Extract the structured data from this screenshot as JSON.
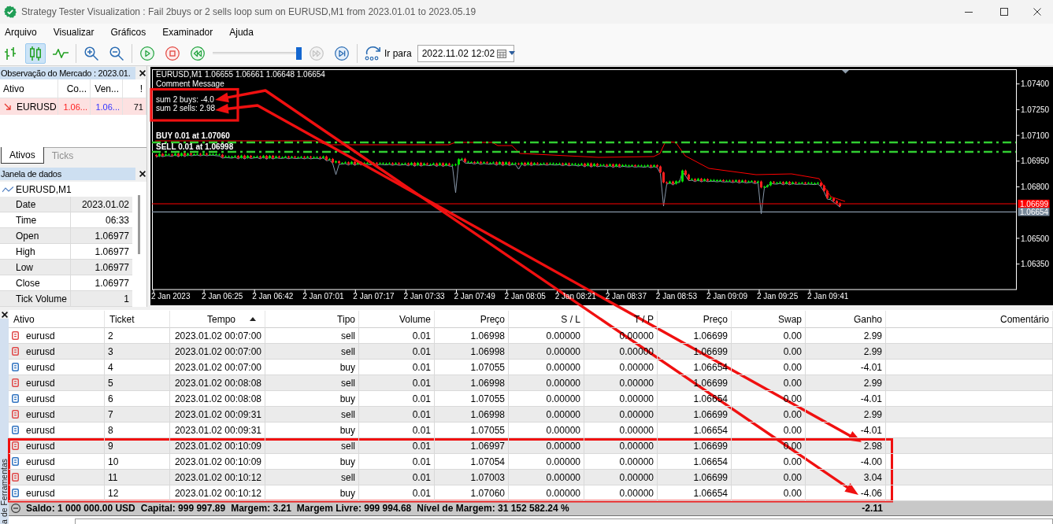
{
  "window": {
    "title": "Strategy Tester Visualization : Fail 2buys or 2 sells loop sum on EURUSD,M1 from 2023.01.01 to 2023.05.19"
  },
  "menu": [
    "Arquivo",
    "Visualizar",
    "Gráficos",
    "Examinador",
    "Ajuda"
  ],
  "toolbar": {
    "chart_modes": [
      {
        "kind": "bars",
        "selected": false
      },
      {
        "kind": "candles",
        "selected": true
      },
      {
        "kind": "line",
        "selected": false
      }
    ],
    "playback": [
      {
        "kind": "play",
        "disabled": false
      },
      {
        "kind": "stop",
        "disabled": false
      },
      {
        "kind": "slower",
        "disabled": false
      }
    ],
    "speed": {
      "level": 1
    },
    "stepping": [
      {
        "kind": "faster",
        "disabled": true
      },
      {
        "kind": "step",
        "disabled": false
      }
    ],
    "go_to": {
      "label": "Ir para",
      "date": "2022.11.02 12:02"
    }
  },
  "market_watch": {
    "title": "Observação do Mercado : 2023.01.",
    "columns": [
      "Ativo",
      "Co...",
      "Ven...",
      "!"
    ],
    "rows": [
      {
        "symbol": "EURUSD",
        "bid": "1.06...",
        "ask": "1.06...",
        "spread": "71",
        "falling": true
      }
    ],
    "tabs": [
      {
        "label": "Ativos",
        "selected": true
      },
      {
        "label": "Ticks",
        "selected": false
      }
    ]
  },
  "data_window": {
    "title": "Janela de dados",
    "series": "EURUSD,M1",
    "rows": [
      {
        "label": "Date",
        "value": "2023.01.02"
      },
      {
        "label": "Time",
        "value": "06:33"
      },
      {
        "label": "Open",
        "value": "1.06977"
      },
      {
        "label": "High",
        "value": "1.06977"
      },
      {
        "label": "Low",
        "value": "1.06977"
      },
      {
        "label": "Close",
        "value": "1.06977"
      },
      {
        "label": "Tick Volume",
        "value": "1"
      }
    ]
  },
  "chart": {
    "symbol": "EURUSD,M1",
    "ohlc": "1.06655 1.06661 1.06648 1.06654",
    "comment": [
      "Comment Message",
      "sum 2 buys: -4.0",
      "sum 2 sells: 2.98"
    ],
    "order_lines": [
      {
        "kind": "buy",
        "label": "BUY 0.01 at 1.07060"
      },
      {
        "kind": "sell",
        "label": "SELL 0.01 at 1.06998"
      }
    ],
    "price_axis": [
      "1.07400",
      "1.07250",
      "1.07100",
      "1.06950",
      "1.06800",
      "1.06500",
      "1.06350"
    ],
    "price_tags": [
      {
        "kind": "ask",
        "label": "1.06699"
      },
      {
        "kind": "bid",
        "label": "1.06654"
      }
    ],
    "time_axis": [
      "2 Jan 2023",
      "2 Jan 06:25",
      "2 Jan 06:42",
      "2 Jan 07:01",
      "2 Jan 07:17",
      "2 Jan 07:33",
      "2 Jan 07:49",
      "2 Jan 08:05",
      "2 Jan 08:21",
      "2 Jan 08:37",
      "2 Jan 08:53",
      "2 Jan 09:09",
      "2 Jan 09:25",
      "2 Jan 09:41"
    ]
  },
  "toolbox": {
    "side_label": "a de Ferramentas",
    "columns": [
      {
        "label": "Ativo",
        "sorted": false
      },
      {
        "label": "Ticket",
        "sorted": false
      },
      {
        "label": "Tempo",
        "sorted": true
      },
      {
        "label": "Tipo",
        "sorted": false
      },
      {
        "label": "Volume",
        "sorted": false
      },
      {
        "label": "Preço",
        "sorted": false
      },
      {
        "label": "S / L",
        "sorted": false
      },
      {
        "label": "T / P",
        "sorted": false
      },
      {
        "label": "Preço",
        "sorted": false
      },
      {
        "label": "Swap",
        "sorted": false
      },
      {
        "label": "Ganho",
        "sorted": false
      },
      {
        "label": "Comentário",
        "sorted": false
      }
    ],
    "rows": [
      {
        "symbol": "eurusd",
        "ticket": "2",
        "time": "2023.01.02 00:07:00",
        "type": "sell",
        "volume": "0.01",
        "open_price": "1.06998",
        "sl": "0.00000",
        "tp": "0.00000",
        "price": "1.06699",
        "swap": "0.00",
        "profit": "2.99",
        "color": "#e04848"
      },
      {
        "symbol": "eurusd",
        "ticket": "3",
        "time": "2023.01.02 00:07:00",
        "type": "sell",
        "volume": "0.01",
        "open_price": "1.06998",
        "sl": "0.00000",
        "tp": "0.00000",
        "price": "1.06699",
        "swap": "0.00",
        "profit": "2.99",
        "color": "#e04848"
      },
      {
        "symbol": "eurusd",
        "ticket": "4",
        "time": "2023.01.02 00:07:00",
        "type": "buy",
        "volume": "0.01",
        "open_price": "1.07055",
        "sl": "0.00000",
        "tp": "0.00000",
        "price": "1.06654",
        "swap": "0.00",
        "profit": "-4.01",
        "color": "#2f72c0"
      },
      {
        "symbol": "eurusd",
        "ticket": "5",
        "time": "2023.01.02 00:08:08",
        "type": "sell",
        "volume": "0.01",
        "open_price": "1.06998",
        "sl": "0.00000",
        "tp": "0.00000",
        "price": "1.06699",
        "swap": "0.00",
        "profit": "2.99",
        "color": "#e04848"
      },
      {
        "symbol": "eurusd",
        "ticket": "6",
        "time": "2023.01.02 00:08:08",
        "type": "buy",
        "volume": "0.01",
        "open_price": "1.07055",
        "sl": "0.00000",
        "tp": "0.00000",
        "price": "1.06654",
        "swap": "0.00",
        "profit": "-4.01",
        "color": "#2f72c0"
      },
      {
        "symbol": "eurusd",
        "ticket": "7",
        "time": "2023.01.02 00:09:31",
        "type": "sell",
        "volume": "0.01",
        "open_price": "1.06998",
        "sl": "0.00000",
        "tp": "0.00000",
        "price": "1.06699",
        "swap": "0.00",
        "profit": "2.99",
        "color": "#e04848"
      },
      {
        "symbol": "eurusd",
        "ticket": "8",
        "time": "2023.01.02 00:09:31",
        "type": "buy",
        "volume": "0.01",
        "open_price": "1.07055",
        "sl": "0.00000",
        "tp": "0.00000",
        "price": "1.06654",
        "swap": "0.00",
        "profit": "-4.01",
        "color": "#2f72c0"
      },
      {
        "symbol": "eurusd",
        "ticket": "9",
        "time": "2023.01.02 00:10:09",
        "type": "sell",
        "volume": "0.01",
        "open_price": "1.06997",
        "sl": "0.00000",
        "tp": "0.00000",
        "price": "1.06699",
        "swap": "0.00",
        "profit": "2.98",
        "color": "#e04848"
      },
      {
        "symbol": "eurusd",
        "ticket": "10",
        "time": "2023.01.02 00:10:09",
        "type": "buy",
        "volume": "0.01",
        "open_price": "1.07054",
        "sl": "0.00000",
        "tp": "0.00000",
        "price": "1.06654",
        "swap": "0.00",
        "profit": "-4.00",
        "color": "#2f72c0"
      },
      {
        "symbol": "eurusd",
        "ticket": "11",
        "time": "2023.01.02 00:10:12",
        "type": "sell",
        "volume": "0.01",
        "open_price": "1.07003",
        "sl": "0.00000",
        "tp": "0.00000",
        "price": "1.06699",
        "swap": "0.00",
        "profit": "3.04",
        "color": "#e04848"
      },
      {
        "symbol": "eurusd",
        "ticket": "12",
        "time": "2023.01.02 00:10:12",
        "type": "buy",
        "volume": "0.01",
        "open_price": "1.07060",
        "sl": "0.00000",
        "tp": "0.00000",
        "price": "1.06654",
        "swap": "0.00",
        "profit": "-4.06",
        "color": "#2f72c0"
      }
    ],
    "summary": [
      "Saldo: 1 000 000.00 USD",
      "Capital: 999 997.89",
      "Margem: 3.21",
      "Margem Livre: 999 994.68",
      "Nível de Margem: 31 152 582.24 %"
    ],
    "total": "-2.11"
  }
}
